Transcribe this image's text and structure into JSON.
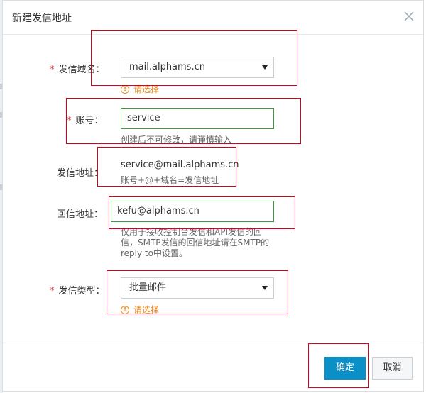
{
  "dialog": {
    "title": "新建发信地址",
    "close_icon": "close-icon"
  },
  "form": {
    "domain": {
      "required_mark": "*",
      "label": "发信域名：",
      "selected": "mail.alphams.cn",
      "warning": "请选择",
      "warning_icon": "!"
    },
    "account": {
      "required_mark": "*",
      "label": "账号：",
      "value": "service",
      "help": "创建后不可修改，请谨慎输入"
    },
    "sender_address": {
      "label": "发信地址：",
      "value": "service@mail.alphams.cn",
      "help": "账号+@+域名=发信地址"
    },
    "reply_address": {
      "label": "回信地址：",
      "value": "kefu@alphams.cn",
      "help_line1": "仅用于接收控制台发信和API发信的回",
      "help_line2": "信，SMTP发信的回信地址请在SMTP的",
      "help_line3": "reply to中设置。"
    },
    "send_type": {
      "required_mark": "*",
      "label": "发信类型：",
      "selected": "批量邮件",
      "warning": "请选择",
      "warning_icon": "!"
    }
  },
  "footer": {
    "confirm_label": "确定",
    "cancel_label": "取消"
  },
  "colors": {
    "primary": "#0b8fc7",
    "warning": "#f08a1c",
    "required": "#e4393c",
    "valid_border": "#3c9d3c",
    "annotation": "#d9001b"
  }
}
